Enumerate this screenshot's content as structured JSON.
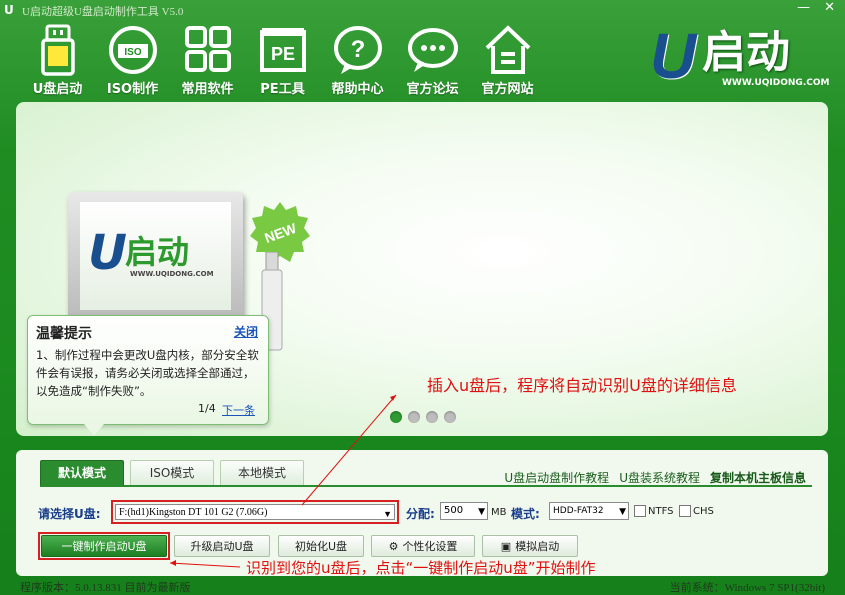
{
  "window": {
    "title": "U启动超级U盘启动制作工具 V5.0",
    "minimize": "—",
    "close": "✕"
  },
  "nav": [
    {
      "label": "U盘启动",
      "icon": "usb-drive-icon"
    },
    {
      "label": "ISO制作",
      "icon": "iso-disc-icon"
    },
    {
      "label": "常用软件",
      "icon": "grid-apps-icon"
    },
    {
      "label": "PE工具",
      "icon": "pe-tool-icon"
    },
    {
      "label": "帮助中心",
      "icon": "help-icon"
    },
    {
      "label": "官方论坛",
      "icon": "forum-chat-icon"
    },
    {
      "label": "官方网站",
      "icon": "home-icon"
    }
  ],
  "brand": {
    "u": "U",
    "name": "启动",
    "url": "WWW.UQIDONG.COM"
  },
  "banner": {
    "laptop_logo_u": "U",
    "laptop_logo_text": "启动",
    "laptop_logo_url": "WWW.UQIDONG.COM",
    "badge": "NEW",
    "annotation": "插入u盘后，程序将自动识别U盘的详细信息"
  },
  "tip": {
    "title": "温馨提示",
    "close": "关闭",
    "body": "1、制作过程中会更改U盘内核，部分安全软件会有误报，请务必关闭或选择全部通过，以免造成“制作失败”。",
    "pager": "1/4",
    "next": "下一条"
  },
  "panel": {
    "tabs": [
      "默认模式",
      "ISO模式",
      "本地模式"
    ],
    "links": [
      "U盘启动盘制作教程",
      "U盘装系统教程",
      "复制本机主板信息"
    ],
    "select_label": "请选择U盘:",
    "select_value": "F:(hd1)Kingston DT 101 G2 (7.06G)",
    "alloc_label": "分配:",
    "alloc_value": "500",
    "alloc_unit": "MB",
    "mode_label": "模式:",
    "mode_value": "HDD-FAT32",
    "ntfs": "NTFS",
    "chs": "CHS",
    "buttons": [
      "一键制作启动U盘",
      "升级启动U盘",
      "初始化U盘",
      "个性化设置",
      "模拟启动"
    ],
    "annotation": "识别到您的u盘后，点击“一键制作启动u盘”开始制作"
  },
  "status": {
    "version": "程序版本：5.0.13.831 目前为最新版",
    "system": "当前系统：Windows 7 SP1(32bit)"
  },
  "colors": {
    "accent": "#2b8b2f",
    "annotation": "#e01010",
    "link": "#1a54b8"
  }
}
